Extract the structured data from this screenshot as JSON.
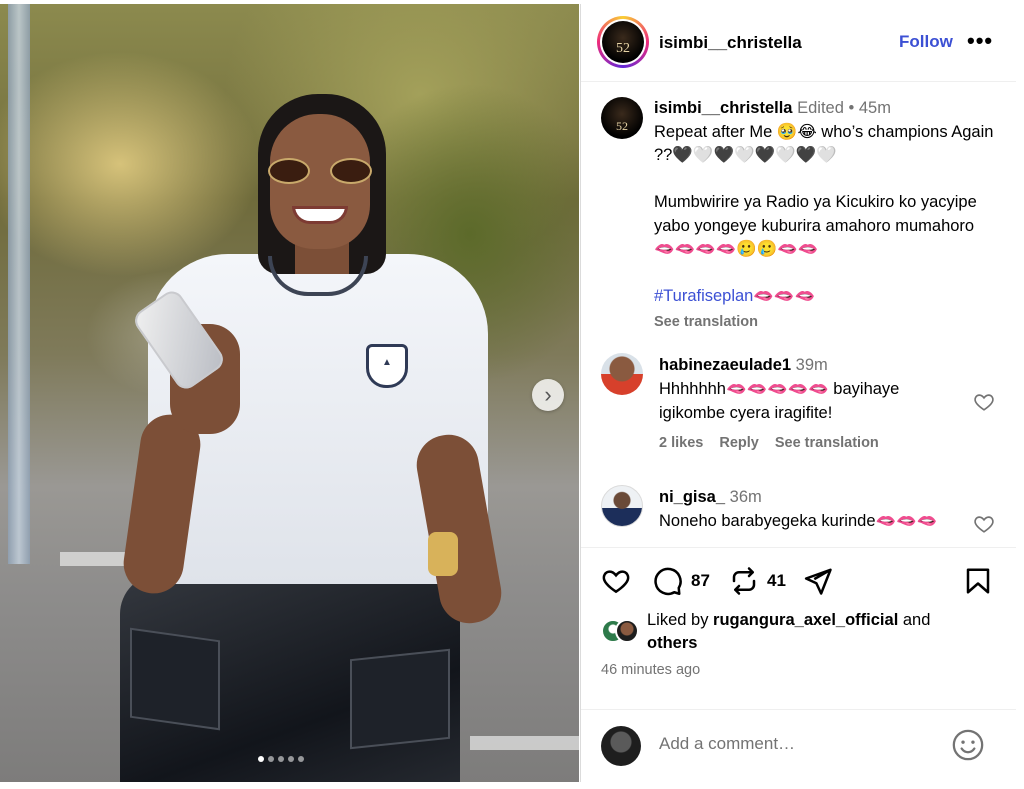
{
  "post": {
    "carousel": {
      "total_images": 5,
      "active_index": 0
    }
  },
  "header": {
    "username": "isimbi__christella",
    "follow_label": "Follow",
    "more_label": "•••",
    "avatar_text": "52"
  },
  "caption": {
    "username": "isimbi__christella",
    "edited_label": "Edited",
    "separator": "•",
    "time": "45m",
    "line1": "Repeat after Me 🥹😂 who’s champions Again ??🖤🤍🖤🤍🖤🤍🖤🤍",
    "line2_text": "Mumbwirire ya Radio ya Kicukiro ko yacyipe yabo yongeye kuburira amahoro mumahoro",
    "line2_emoji": "🫦🫦🫦🫦🥲🥲🫦🫦",
    "hashtag": "#Turafiseplan",
    "hashtag_emoji": "🫦🫦🫦",
    "see_translation": "See translation"
  },
  "comments": [
    {
      "username": "habinezaeulade1",
      "time": "39m",
      "text_start": "Hhhhhhh",
      "emoji": "🫦🫦🫦🫦🫦",
      "text_end": " bayihaye igikombe cyera iragifite!",
      "likes": "2 likes",
      "reply": "Reply",
      "see_translation": "See translation"
    },
    {
      "username": "ni_gisa_",
      "time": "36m",
      "text": "Noneho barabyegeka kurinde",
      "emoji": "🫦🫦🫦"
    }
  ],
  "actions": {
    "comments_count": "87",
    "reposts_count": "41"
  },
  "likes": {
    "prefix": "Liked by ",
    "user": "rugangura_axel_official",
    "middle": " and",
    "others": "others"
  },
  "timestamp": "46 minutes ago",
  "add_comment": {
    "placeholder": "Add a comment…"
  },
  "colors": {
    "accent": "#3c50d4",
    "meta": "#737373",
    "border": "#dbdbdb"
  },
  "icons": [
    "chevron-right-icon",
    "heart-icon",
    "comment-icon",
    "repost-icon",
    "share-icon",
    "bookmark-icon",
    "emoji-icon"
  ]
}
